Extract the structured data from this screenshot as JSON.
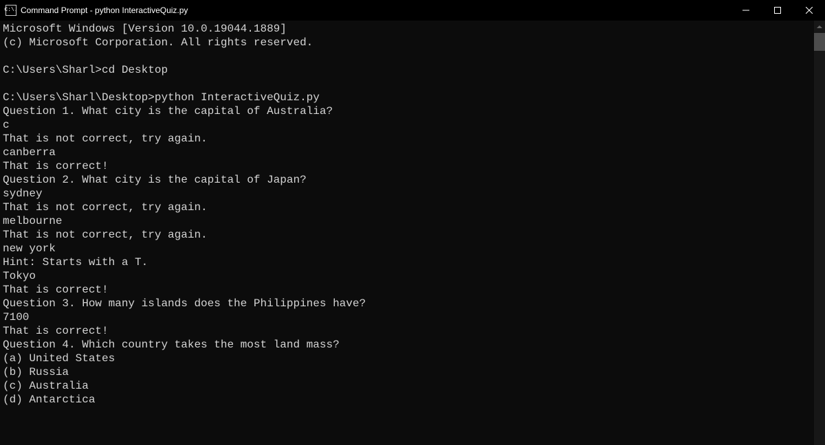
{
  "titlebar": {
    "title": "Command Prompt - python  InteractiveQuiz.py",
    "icon_label": "C:\\."
  },
  "terminal": {
    "lines": [
      "Microsoft Windows [Version 10.0.19044.1889]",
      "(c) Microsoft Corporation. All rights reserved.",
      "",
      "C:\\Users\\Sharl>cd Desktop",
      "",
      "C:\\Users\\Sharl\\Desktop>python InteractiveQuiz.py",
      "Question 1. What city is the capital of Australia?",
      "c",
      "That is not correct, try again.",
      "canberra",
      "That is correct!",
      "Question 2. What city is the capital of Japan?",
      "sydney",
      "That is not correct, try again.",
      "melbourne",
      "That is not correct, try again.",
      "new york",
      "Hint: Starts with a T.",
      "Tokyo",
      "That is correct!",
      "Question 3. How many islands does the Philippines have?",
      "7100",
      "That is correct!",
      "Question 4. Which country takes the most land mass?",
      "(a) United States",
      "(b) Russia",
      "(c) Australia",
      "(d) Antarctica"
    ]
  }
}
